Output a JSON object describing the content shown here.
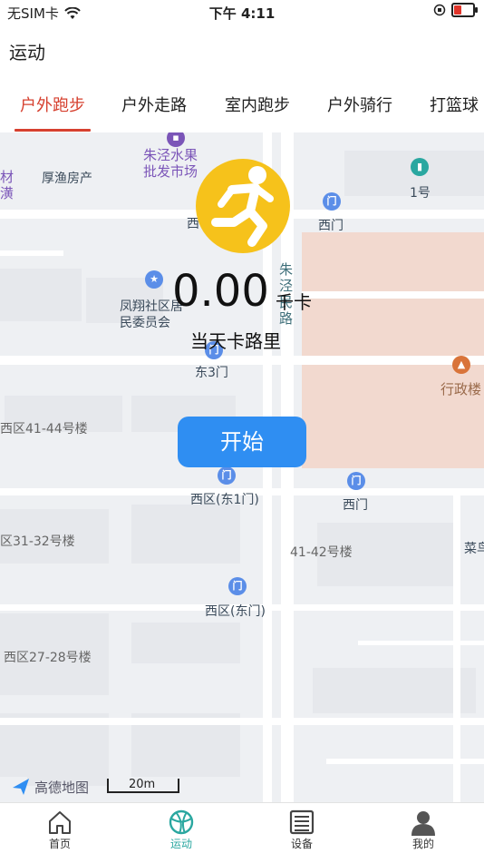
{
  "status": {
    "carrier": "无SIM卡",
    "time": "下午 4:11"
  },
  "header": {
    "title": "运动"
  },
  "tabs": [
    {
      "label": "户外跑步",
      "active": true
    },
    {
      "label": "户外走路",
      "active": false
    },
    {
      "label": "室内跑步",
      "active": false
    },
    {
      "label": "户外骑行",
      "active": false
    },
    {
      "label": "打篮球",
      "active": false
    }
  ],
  "map": {
    "labels": {
      "l1": "朱泾水果\n批发市场",
      "l2": "厚渔房产",
      "l3": "材\n潢",
      "l4": "西",
      "l5": "西门",
      "l6": "1号",
      "l7": "凤翔社区居\n民委员会",
      "l8": "朱\n泾\n民\n路",
      "l9": "东3门",
      "l10": "行政楼",
      "l11": "西区41-44号楼",
      "l12": "西区(东1门)",
      "l13": "西门",
      "l14": "区31-32号楼",
      "l15": "41-42号楼",
      "l16": "菜鸟",
      "l17": "西区(东门)",
      "l18": "西区27-28号楼"
    },
    "attribution": "高德地图",
    "scale": "20m"
  },
  "workout": {
    "distance": "0.00",
    "unit": "千卡",
    "label": "当天卡路里"
  },
  "start_button": "开始",
  "nav": [
    {
      "label": "首页",
      "icon": "home-icon",
      "active": false
    },
    {
      "label": "运动",
      "icon": "basketball-icon",
      "active": true
    },
    {
      "label": "设备",
      "icon": "device-icon",
      "active": false
    },
    {
      "label": "我的",
      "icon": "profile-icon",
      "active": false
    }
  ],
  "colors": {
    "accent": "#d6402f",
    "primary_button": "#2f8ef2",
    "runner_badge": "#f6c21b",
    "nav_active": "#2aa7a0"
  }
}
